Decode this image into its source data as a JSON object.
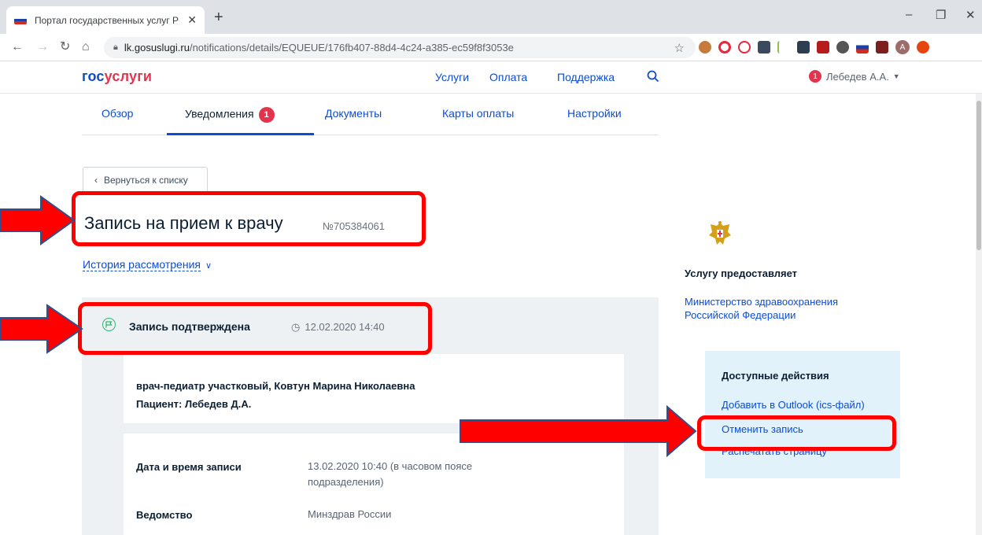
{
  "browser": {
    "tab_title": "Портал государственных услуг Р",
    "tab_close": "✕",
    "new_tab": "+",
    "url_domain": "lk.gosuslugi.ru",
    "url_path": "/notifications/details/EQUEUE/176fb407-88d4-4c24-a385-ec59f8f3053e",
    "profile_initial": "A"
  },
  "header": {
    "logo_part1": "гос",
    "logo_part2": "услуги",
    "nav": [
      "Услуги",
      "Оплата",
      "Поддержка"
    ],
    "user_badge": "1",
    "user_name": "Лебедев А.А."
  },
  "subnav": {
    "tabs": [
      "Обзор",
      "Уведомления",
      "Документы",
      "Карты оплаты",
      "Настройки"
    ],
    "notifications_count": "1"
  },
  "main": {
    "back_label": "Вернуться к списку",
    "title": "Запись на прием к врачу",
    "number": "№705384061",
    "history_label": "История рассмотрения",
    "status": {
      "title": "Запись подтверждена",
      "time": "12.02.2020 14:40"
    },
    "doctor_line": "врач-педиатр участковый, Ковтун Марина Николаевна",
    "patient_line": "Пациент: Лебедев Д.А.",
    "details": [
      {
        "label": "Дата и время записи",
        "value": "13.02.2020 10:40 (в часовом поясе подразделения)"
      },
      {
        "label": "Ведомство",
        "value": "Минздрав России"
      }
    ]
  },
  "sidebar": {
    "provider_label": "Услугу предоставляет",
    "provider_name": "Министерство здравоохранения Российской Федерации",
    "actions_title": "Доступные действия",
    "actions": [
      "Добавить в Outlook (ics-файл)",
      "Отменить запись",
      "Распечатать страницу"
    ]
  },
  "colors": {
    "brand_blue": "#0d4cd3",
    "brand_red": "#e4344d",
    "annotation_red": "#ff0000",
    "status_green": "#2eb673",
    "actions_bg": "#e2f2fb"
  }
}
